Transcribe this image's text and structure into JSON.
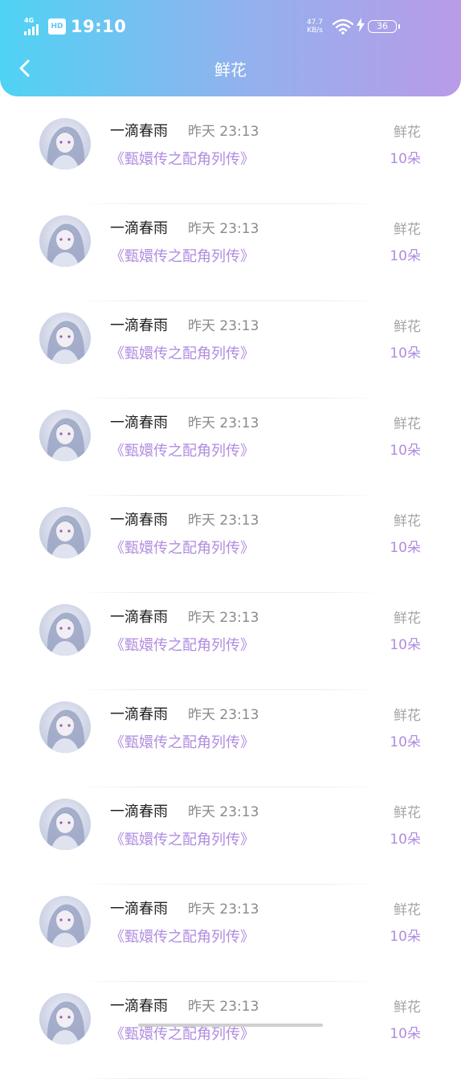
{
  "status_bar": {
    "network": "4G",
    "hd": "HD",
    "time": "19:10",
    "net_speed_value": "47.7",
    "net_speed_unit": "KB/s",
    "battery": "36"
  },
  "nav": {
    "title": "鲜花",
    "back_icon": "chevron-left-icon"
  },
  "records": [
    {
      "name": "一滴春雨",
      "time": "昨天 23:13",
      "book": "《甄嬛传之配角列传》",
      "gift_type": "鲜花",
      "gift_count": "10朵"
    },
    {
      "name": "一滴春雨",
      "time": "昨天 23:13",
      "book": "《甄嬛传之配角列传》",
      "gift_type": "鲜花",
      "gift_count": "10朵"
    },
    {
      "name": "一滴春雨",
      "time": "昨天 23:13",
      "book": "《甄嬛传之配角列传》",
      "gift_type": "鲜花",
      "gift_count": "10朵"
    },
    {
      "name": "一滴春雨",
      "time": "昨天 23:13",
      "book": "《甄嬛传之配角列传》",
      "gift_type": "鲜花",
      "gift_count": "10朵"
    },
    {
      "name": "一滴春雨",
      "time": "昨天 23:13",
      "book": "《甄嬛传之配角列传》",
      "gift_type": "鲜花",
      "gift_count": "10朵"
    },
    {
      "name": "一滴春雨",
      "time": "昨天 23:13",
      "book": "《甄嬛传之配角列传》",
      "gift_type": "鲜花",
      "gift_count": "10朵"
    },
    {
      "name": "一滴春雨",
      "time": "昨天 23:13",
      "book": "《甄嬛传之配角列传》",
      "gift_type": "鲜花",
      "gift_count": "10朵"
    },
    {
      "name": "一滴春雨",
      "time": "昨天 23:13",
      "book": "《甄嬛传之配角列传》",
      "gift_type": "鲜花",
      "gift_count": "10朵"
    },
    {
      "name": "一滴春雨",
      "time": "昨天 23:13",
      "book": "《甄嬛传之配角列传》",
      "gift_type": "鲜花",
      "gift_count": "10朵"
    },
    {
      "name": "一滴春雨",
      "time": "昨天 23:13",
      "book": "《甄嬛传之配角列传》",
      "gift_type": "鲜花",
      "gift_count": "10朵"
    }
  ],
  "colors": {
    "header_gradient_start": "#4fd3f4",
    "header_gradient_end": "#b99be8",
    "accent_purple": "#b08ce0",
    "muted_gray": "#a5a5a5"
  }
}
